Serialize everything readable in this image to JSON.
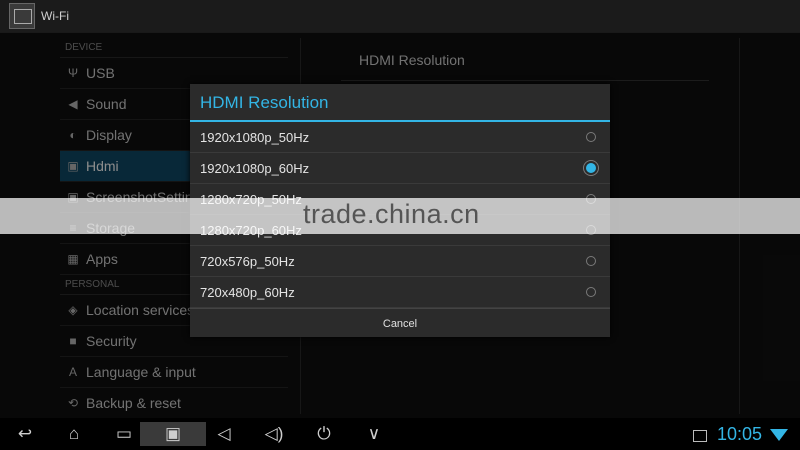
{
  "app": {
    "title": "Wi-Fi"
  },
  "sidebar": {
    "device_header": "DEVICE",
    "device_items": [
      {
        "icon": "usb-icon",
        "glyph": "Ψ",
        "label": "USB"
      },
      {
        "icon": "sound-icon",
        "glyph": "◀",
        "label": "Sound"
      },
      {
        "icon": "display-icon",
        "glyph": "◐",
        "label": "Display"
      },
      {
        "icon": "hdmi-icon",
        "glyph": "▣",
        "label": "Hdmi"
      },
      {
        "icon": "screenshot-icon",
        "glyph": "▣",
        "label": "ScreenshotSetting"
      },
      {
        "icon": "storage-icon",
        "glyph": "≡",
        "label": "Storage"
      },
      {
        "icon": "apps-icon",
        "glyph": "▦",
        "label": "Apps"
      }
    ],
    "personal_header": "PERSONAL",
    "personal_items": [
      {
        "icon": "location-icon",
        "glyph": "◈",
        "label": "Location services"
      },
      {
        "icon": "lock-icon",
        "glyph": "■",
        "label": "Security"
      },
      {
        "icon": "language-icon",
        "glyph": "A",
        "label": "Language & input"
      },
      {
        "icon": "backup-icon",
        "glyph": "⟲",
        "label": "Backup & reset"
      }
    ]
  },
  "pane": {
    "title": "HDMI Resolution"
  },
  "dialog": {
    "title": "HDMI Resolution",
    "options": [
      {
        "label": "1920x1080p_50Hz",
        "selected": false
      },
      {
        "label": "1920x1080p_60Hz",
        "selected": true
      },
      {
        "label": "1280x720p_50Hz",
        "selected": false
      },
      {
        "label": "1280x720p_60Hz",
        "selected": false
      },
      {
        "label": "720x576p_50Hz",
        "selected": false
      },
      {
        "label": "720x480p_60Hz",
        "selected": false
      }
    ],
    "cancel_label": "Cancel"
  },
  "watermark": {
    "text": "trade.china.cn"
  },
  "navbar": {
    "time": "10:05",
    "buttons": [
      {
        "name": "back-button",
        "glyph": "↩"
      },
      {
        "name": "home-button",
        "glyph": "⌂"
      },
      {
        "name": "recents-button",
        "glyph": "▭"
      },
      {
        "name": "screenshot-button",
        "glyph": "▣"
      },
      {
        "name": "volume-down-button",
        "glyph": "◁"
      },
      {
        "name": "volume-up-button",
        "glyph": "◁)"
      },
      {
        "name": "power-button",
        "glyph": "⏻"
      },
      {
        "name": "menu-button",
        "glyph": "∨"
      }
    ]
  },
  "colors": {
    "accent": "#33b5e5",
    "active_item": "#104a66",
    "background": "#101010"
  }
}
